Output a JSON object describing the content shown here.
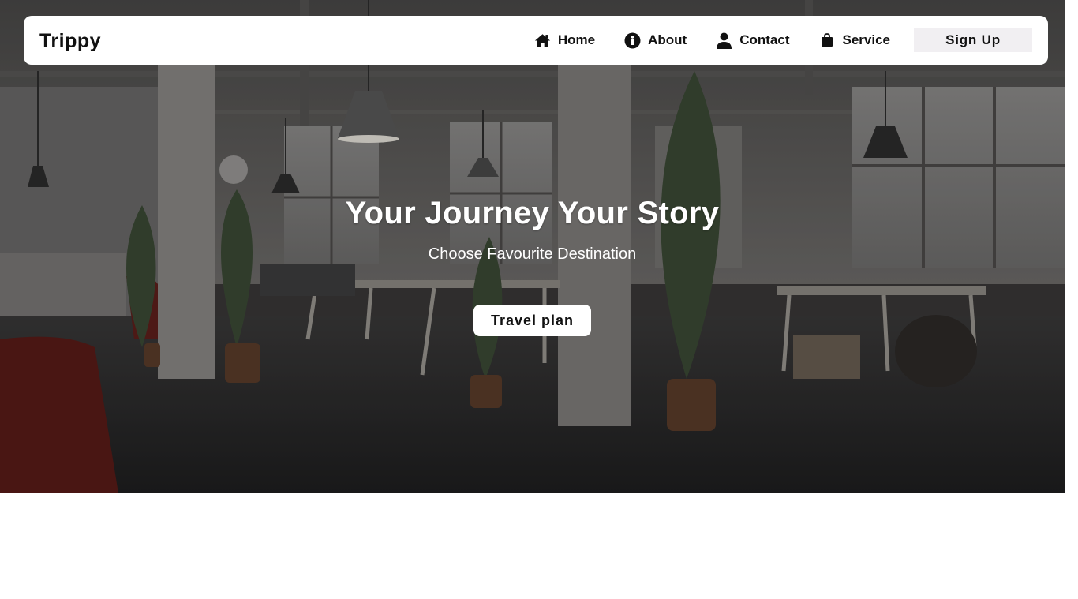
{
  "navbar": {
    "brand": "Trippy",
    "links": [
      {
        "label": "Home",
        "icon": "home-icon"
      },
      {
        "label": "About",
        "icon": "info-icon"
      },
      {
        "label": "Contact",
        "icon": "user-icon"
      },
      {
        "label": "Service",
        "icon": "shopping-bag-icon"
      }
    ],
    "signup_label": "Sign Up"
  },
  "hero": {
    "title": "Your Journey Your Story",
    "subtitle": "Choose Favourite Destination",
    "button_label": "Travel plan",
    "background_image": "office-interior-photo"
  },
  "colors": {
    "navbar_bg": "#ffffff",
    "signup_bg": "#f1eff2",
    "text_dark": "#111111",
    "hero_text": "#ffffff"
  }
}
